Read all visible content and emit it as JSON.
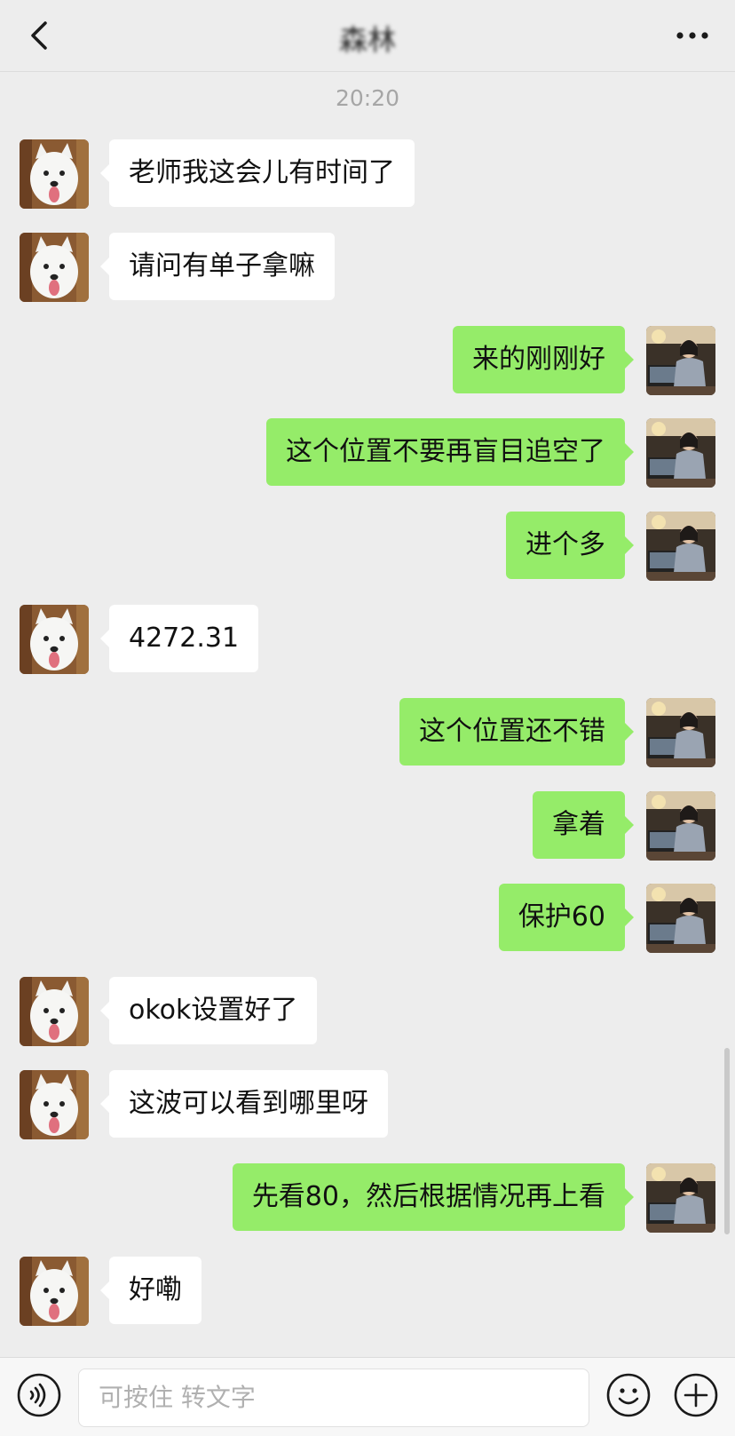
{
  "header": {
    "title": "森林",
    "back_icon": "chevron-left-icon",
    "more_icon": "more-dots-icon"
  },
  "timestamp": "20:20",
  "messages": [
    {
      "side": "left",
      "text": "老师我这会儿有时间了"
    },
    {
      "side": "left",
      "text": "请问有单子拿嘛"
    },
    {
      "side": "right",
      "text": "来的刚刚好"
    },
    {
      "side": "right",
      "text": "这个位置不要再盲目追空了"
    },
    {
      "side": "right",
      "text": "进个多"
    },
    {
      "side": "left",
      "text": "4272.31"
    },
    {
      "side": "right",
      "text": "这个位置还不错"
    },
    {
      "side": "right",
      "text": "拿着"
    },
    {
      "side": "right",
      "text": "保护60"
    },
    {
      "side": "left",
      "text": "okok设置好了"
    },
    {
      "side": "left",
      "text": "这波可以看到哪里呀"
    },
    {
      "side": "right",
      "text": "先看80，然后根据情况再上看"
    },
    {
      "side": "left",
      "text": "好嘞"
    }
  ],
  "input": {
    "placeholder": "可按住 转文字"
  },
  "colors": {
    "self_bubble": "#95ec69",
    "other_bubble": "#ffffff",
    "background": "#ededed"
  }
}
